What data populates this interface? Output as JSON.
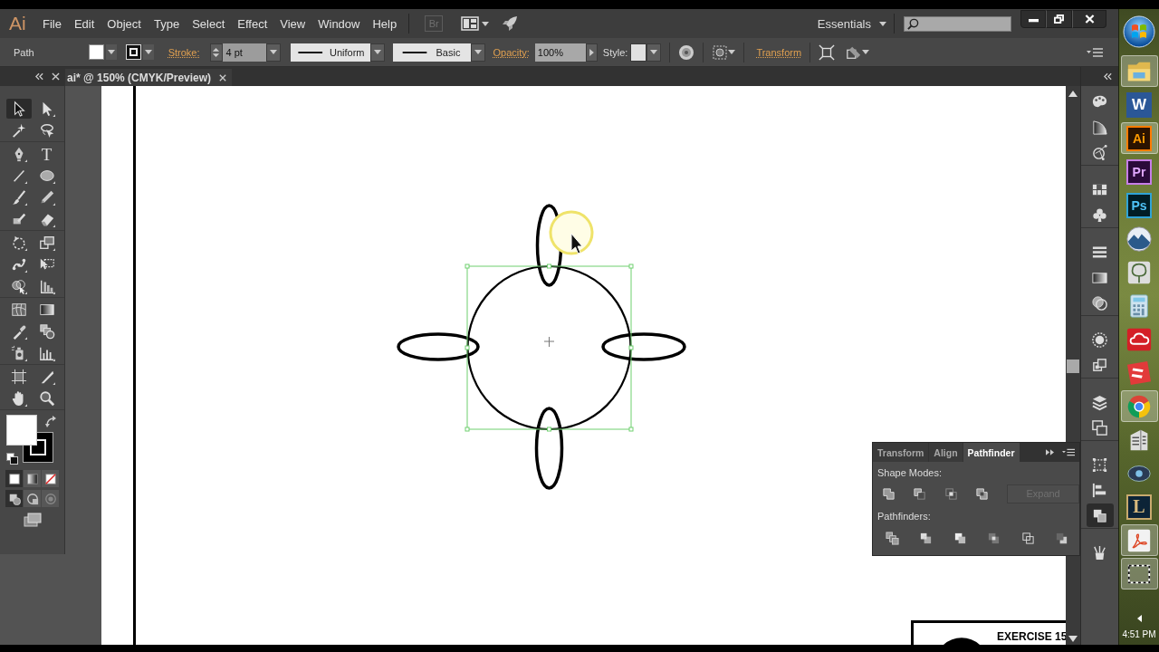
{
  "app": {
    "logo": "Ai",
    "menus": [
      "File",
      "Edit",
      "Object",
      "Type",
      "Select",
      "Effect",
      "View",
      "Window",
      "Help"
    ],
    "bridge": "Br",
    "workspace": "Essentials"
  },
  "control_bar": {
    "selection": "Path",
    "stroke_label": "Stroke:",
    "stroke_weight": "4 pt",
    "profile": "Uniform",
    "brush": "Basic",
    "opacity_label": "Opacity:",
    "opacity": "100%",
    "style_label": "Style:",
    "transform_link": "Transform"
  },
  "document_tab": {
    "title": "ai* @ 150% (CMYK/Preview)"
  },
  "tools": [
    {
      "selected": true
    },
    {
      "selected": false
    },
    {
      "selected": false
    },
    {
      "selected": false
    },
    {
      "selected": false
    },
    {
      "label": "T",
      "selected": false
    },
    {
      "selected": false
    },
    {
      "selected": false
    },
    {
      "selected": false
    },
    {
      "selected": false
    },
    {
      "selected": false
    },
    {
      "selected": false
    },
    {
      "selected": false
    },
    {
      "selected": false
    },
    {
      "selected": false
    },
    {
      "selected": false
    },
    {
      "selected": false
    },
    {
      "selected": false
    },
    {
      "selected": false
    },
    {
      "selected": false
    },
    {
      "selected": false
    },
    {
      "selected": false
    },
    {
      "selected": false
    },
    {
      "selected": false
    },
    {
      "selected": false
    },
    {
      "selected": false
    },
    {
      "selected": false
    },
    {
      "selected": false
    }
  ],
  "color_modes": [
    {
      "selected": true
    },
    {
      "selected": false
    },
    {
      "selected": false
    }
  ],
  "draw_modes": [
    {
      "selected": true
    },
    {
      "selected": false
    },
    {
      "selected": false
    }
  ],
  "canvas": {
    "exercise_label": "EXERCISE 15"
  },
  "pathfinder_panel": {
    "tabs": [
      {
        "label": "Transform",
        "selected": false
      },
      {
        "label": "Align",
        "selected": false
      },
      {
        "label": "Pathfinder",
        "selected": true
      }
    ],
    "shape_modes_label": "Shape Modes:",
    "expand": {
      "label": "Expand",
      "disabled": true
    },
    "pathfinders_label": "Pathfinders:"
  },
  "dock_icons": [
    {
      "selected": false
    },
    {
      "selected": false
    },
    {
      "selected": false
    },
    {
      "selected": false
    },
    {
      "selected": false
    },
    {
      "selected": false
    },
    {
      "selected": false
    },
    {
      "selected": false
    },
    {
      "selected": false
    },
    {
      "selected": false
    },
    {
      "selected": false
    },
    {
      "selected": false
    },
    {
      "selected": false
    },
    {
      "selected": false
    },
    {
      "selected": true
    },
    {
      "selected": false
    }
  ],
  "taskbar": {
    "items": [
      {
        "running": true
      },
      {
        "label": "W",
        "running": false
      },
      {
        "label": "Ai",
        "running": true
      },
      {
        "label": "Pr",
        "running": false
      },
      {
        "label": "Ps",
        "running": false
      },
      {
        "running": false
      },
      {
        "running": false
      },
      {
        "running": false
      },
      {
        "running": false
      },
      {
        "running": false
      },
      {
        "running": true
      },
      {
        "running": false
      },
      {
        "running": false
      },
      {
        "label": "L",
        "running": false
      },
      {
        "running": true
      },
      {
        "running": true
      }
    ],
    "clock": "4:51 PM"
  }
}
